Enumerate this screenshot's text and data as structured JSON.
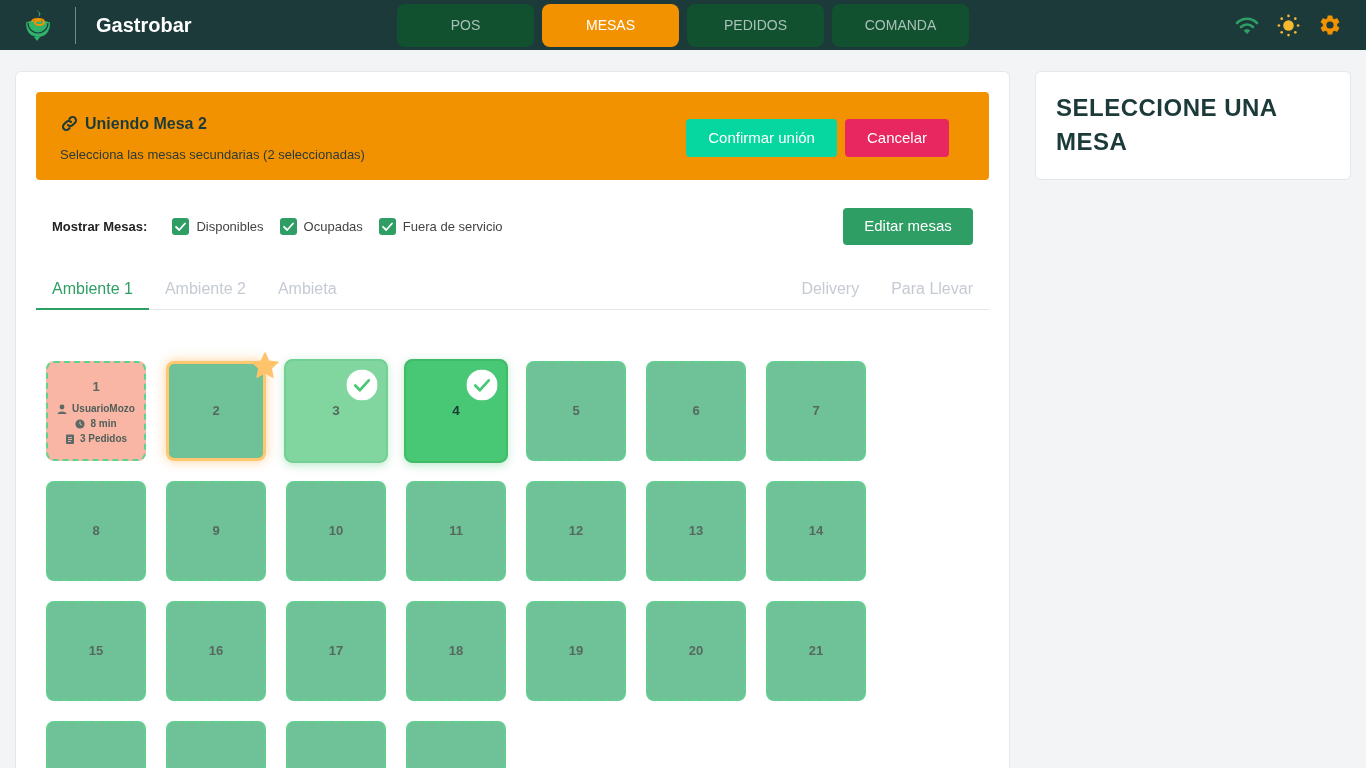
{
  "header": {
    "app_name": "Gastrobar",
    "nav": [
      {
        "label": "POS",
        "selected": false
      },
      {
        "label": "MESAS",
        "selected": true
      },
      {
        "label": "PEDIDOS",
        "selected": false
      },
      {
        "label": "COMANDA",
        "selected": false
      }
    ]
  },
  "join_banner": {
    "title": "Uniendo Mesa 2",
    "message": "Selecciona las mesas secundarias (2 seleccionadas)",
    "buttons": [
      {
        "label": "Confirmar unión",
        "kind": "confirm"
      },
      {
        "label": "Cancelar",
        "kind": "cancel"
      }
    ]
  },
  "filters": {
    "label": "Mostrar Mesas:",
    "options": [
      {
        "label": "Disponibles",
        "checked": true
      },
      {
        "label": "Ocupadas",
        "checked": true
      },
      {
        "label": "Fuera de servicio",
        "checked": true
      }
    ],
    "edit_button": "Editar mesas"
  },
  "area_tabs": [
    {
      "label": "Ambiente 1",
      "kind": "room",
      "selected": true
    },
    {
      "label": "Ambiente 2",
      "kind": "room",
      "selected": false
    },
    {
      "label": "Ambieta",
      "kind": "room",
      "selected": false
    },
    {
      "label": "Delivery",
      "kind": "service",
      "selected": false
    },
    {
      "label": "Para Llevar",
      "kind": "service",
      "selected": false
    }
  ],
  "tables": [
    {
      "number": "1",
      "kind": "occupied",
      "waiter": "UsuarioMozo",
      "time": "8 min",
      "orders": "3 Pedidos",
      "primary": false,
      "selected": false,
      "hovered": false
    },
    {
      "number": "2",
      "kind": "available",
      "primary": true,
      "selected": false,
      "hovered": false
    },
    {
      "number": "3",
      "kind": "available",
      "primary": false,
      "selected": true,
      "hovered": false
    },
    {
      "number": "4",
      "kind": "available",
      "primary": false,
      "selected": true,
      "hovered": true
    },
    {
      "number": "5",
      "kind": "available",
      "primary": false,
      "selected": false,
      "hovered": false
    },
    {
      "number": "6",
      "kind": "available",
      "primary": false,
      "selected": false,
      "hovered": false
    },
    {
      "number": "7",
      "kind": "available",
      "primary": false,
      "selected": false,
      "hovered": false
    },
    {
      "number": "8",
      "kind": "available",
      "primary": false,
      "selected": false,
      "hovered": false
    },
    {
      "number": "9",
      "kind": "available",
      "primary": false,
      "selected": false,
      "hovered": false
    },
    {
      "number": "10",
      "kind": "available",
      "primary": false,
      "selected": false,
      "hovered": false
    },
    {
      "number": "11",
      "kind": "available",
      "primary": false,
      "selected": false,
      "hovered": false
    },
    {
      "number": "12",
      "kind": "available",
      "primary": false,
      "selected": false,
      "hovered": false
    },
    {
      "number": "13",
      "kind": "available",
      "primary": false,
      "selected": false,
      "hovered": false
    },
    {
      "number": "14",
      "kind": "available",
      "primary": false,
      "selected": false,
      "hovered": false
    },
    {
      "number": "15",
      "kind": "available",
      "primary": false,
      "selected": false,
      "hovered": false
    },
    {
      "number": "16",
      "kind": "available",
      "primary": false,
      "selected": false,
      "hovered": false
    },
    {
      "number": "17",
      "kind": "available",
      "primary": false,
      "selected": false,
      "hovered": false
    },
    {
      "number": "18",
      "kind": "available",
      "primary": false,
      "selected": false,
      "hovered": false
    },
    {
      "number": "19",
      "kind": "available",
      "primary": false,
      "selected": false,
      "hovered": false
    },
    {
      "number": "20",
      "kind": "available",
      "primary": false,
      "selected": false,
      "hovered": false
    },
    {
      "number": "21",
      "kind": "available",
      "primary": false,
      "selected": false,
      "hovered": false
    },
    {
      "kind": "available",
      "primary": false,
      "selected": false,
      "hovered": false
    },
    {
      "kind": "available",
      "primary": false,
      "selected": false,
      "hovered": false
    },
    {
      "kind": "available",
      "primary": false,
      "selected": false,
      "hovered": false
    },
    {
      "kind": "available",
      "primary": false,
      "selected": false,
      "hovered": false
    }
  ],
  "side_panel": {
    "title": "SELECCIONE UNA MESA"
  }
}
